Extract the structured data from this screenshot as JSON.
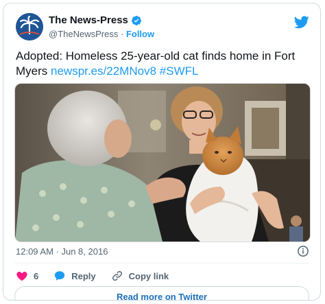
{
  "tweet": {
    "author_name": "The News-Press",
    "author_handle": "@TheNewsPress",
    "separator": "·",
    "follow_label": "Follow",
    "text": "Adopted: Homeless 25-year-old cat finds home in Fort Myers",
    "link": "newspr.es/22MNov8",
    "hashtag": "#SWFL",
    "timestamp": "12:09 AM · Jun 8, 2016",
    "like_count": "6",
    "reply_label": "Reply",
    "copy_link_label": "Copy link",
    "read_more_label": "Read more on Twitter"
  },
  "icons": {
    "brand": "twitter-bird-icon",
    "verified": "verified-badge-icon",
    "info": "info-icon",
    "like": "heart-icon",
    "reply": "speech-bubble-icon",
    "copy_link": "link-icon"
  },
  "colors": {
    "accent": "#1d9bf0",
    "like": "#f91880",
    "muted": "#536471",
    "text": "#0f1419"
  }
}
